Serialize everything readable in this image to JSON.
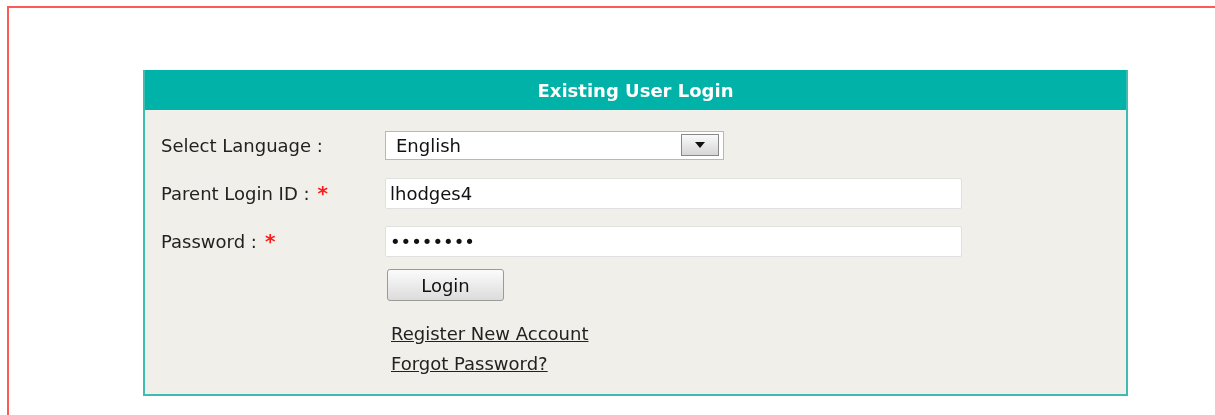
{
  "login_panel": {
    "title": "Existing User Login",
    "fields": [
      {
        "kind": "select",
        "label": "Select Language :",
        "value": "English"
      },
      {
        "kind": "text",
        "label": "Parent Login ID :",
        "value": "lhodges4",
        "required_mark": "*"
      },
      {
        "kind": "text",
        "label": "Password :",
        "value": "••••••••",
        "required_mark": "*"
      }
    ],
    "button": "Login",
    "links": [
      "Register New Account",
      "Forgot Password?"
    ]
  }
}
